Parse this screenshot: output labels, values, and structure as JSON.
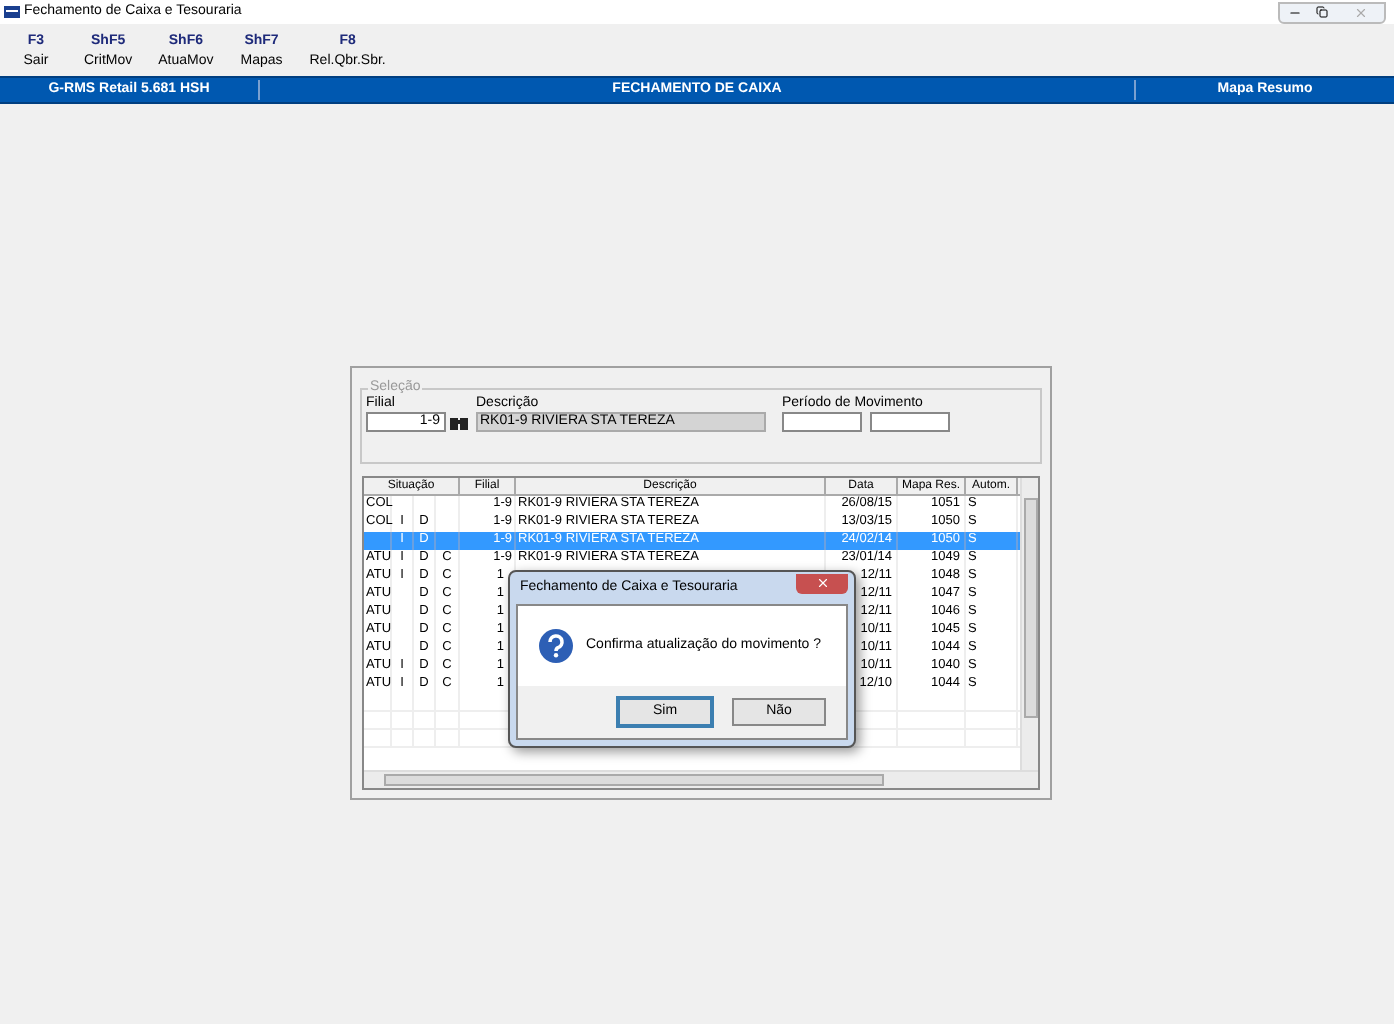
{
  "window": {
    "title": "Fechamento de Caixa e Tesouraria"
  },
  "toolbar": [
    {
      "key": "F3",
      "label": "Sair"
    },
    {
      "key": "ShF5",
      "label": "CritMov"
    },
    {
      "key": "ShF6",
      "label": "AtuaMov"
    },
    {
      "key": "ShF7",
      "label": "Mapas"
    },
    {
      "key": "F8",
      "label": "Rel.Qbr.Sbr."
    }
  ],
  "banner": {
    "left": "G-RMS Retail 5.681 HSH",
    "center": "FECHAMENTO DE CAIXA",
    "right": "Mapa Resumo"
  },
  "selection": {
    "legend": "Seleção",
    "filial_label": "Filial",
    "filial_value": "1-9",
    "descricao_label": "Descrição",
    "descricao_value": "RK01-9 RIVIERA STA TEREZA",
    "periodo_label": "Período de Movimento"
  },
  "table": {
    "columns": [
      "Situação",
      "Filial",
      "Descrição",
      "Data",
      "Mapa Res.",
      "Autom."
    ],
    "rows": [
      {
        "selected": false,
        "sit": {
          "col_1": "COL"
        },
        "filial": "1-9",
        "descricao": "RK01-9 RIVIERA STA TEREZA",
        "data": "26/08/15",
        "mapa": "1051",
        "autom": "S"
      },
      {
        "selected": false,
        "sit": {
          "col_1": "COL",
          "col_2": "I",
          "col_3": "D"
        },
        "filial": "1-9",
        "descricao": "RK01-9 RIVIERA STA TEREZA",
        "data": "13/03/15",
        "mapa": "1050",
        "autom": "S"
      },
      {
        "selected": true,
        "sit": {
          "col_2": "I",
          "col_3": "D"
        },
        "filial": "1-9",
        "descricao": "RK01-9 RIVIERA STA TEREZA",
        "data": "24/02/14",
        "mapa": "1050",
        "autom": "S"
      },
      {
        "selected": false,
        "sit": {
          "col_1": "ATU",
          "col_2": "I",
          "col_3": "D",
          "col_4": "C"
        },
        "filial": "1-9",
        "descricao": "RK01-9 RIVIERA STA TEREZA",
        "data": "23/01/14",
        "mapa": "1049",
        "autom": "S"
      },
      {
        "selected": false,
        "sit": {
          "col_1": "ATU",
          "col_2": "I",
          "col_3": "D",
          "col_4": "C"
        },
        "filial": "1",
        "data": "12/11",
        "mapa": "1048",
        "autom": "S"
      },
      {
        "selected": false,
        "sit": {
          "col_1": "ATU",
          "col_3": "D",
          "col_4": "C"
        },
        "filial": "1",
        "data": "12/11",
        "mapa": "1047",
        "autom": "S"
      },
      {
        "selected": false,
        "sit": {
          "col_1": "ATU",
          "col_3": "D",
          "col_4": "C"
        },
        "filial": "1",
        "data": "12/11",
        "mapa": "1046",
        "autom": "S"
      },
      {
        "selected": false,
        "sit": {
          "col_1": "ATU",
          "col_3": "D",
          "col_4": "C"
        },
        "filial": "1",
        "data": "10/11",
        "mapa": "1045",
        "autom": "S"
      },
      {
        "selected": false,
        "sit": {
          "col_1": "ATU",
          "col_3": "D",
          "col_4": "C"
        },
        "filial": "1",
        "data": "10/11",
        "mapa": "1044",
        "autom": "S"
      },
      {
        "selected": false,
        "sit": {
          "col_1": "ATU",
          "col_2": "I",
          "col_3": "D",
          "col_4": "C"
        },
        "filial": "1",
        "data": "10/11",
        "mapa": "1040",
        "autom": "S"
      },
      {
        "selected": false,
        "sit": {
          "col_1": "ATU",
          "col_2": "I",
          "col_3": "D",
          "col_4": "C"
        },
        "filial": "1",
        "data": "12/10",
        "mapa": "1044",
        "autom": "S"
      }
    ]
  },
  "dialog": {
    "title": "Fechamento de Caixa e Tesouraria",
    "message": "Confirma atualização do movimento ?",
    "buttons": [
      {
        "label": "Sim",
        "default": true
      },
      {
        "label": "Não",
        "default": false
      }
    ]
  }
}
